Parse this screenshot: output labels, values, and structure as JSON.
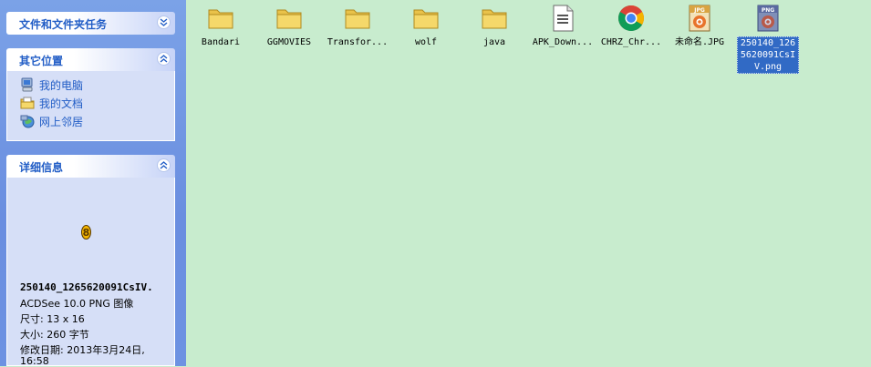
{
  "sidebar": {
    "tasks_panel": {
      "title": "文件和文件夹任务"
    },
    "places_panel": {
      "title": "其它位置",
      "links": [
        {
          "label": "我的电脑",
          "icon": "my-computer-icon"
        },
        {
          "label": "我的文档",
          "icon": "my-documents-icon"
        },
        {
          "label": "网上邻居",
          "icon": "network-places-icon"
        }
      ]
    },
    "details_panel": {
      "title": "详细信息",
      "filename": "250140_1265620091CsIV.",
      "filetype": "ACDSee 10.0 PNG 图像",
      "dimensions": "尺寸: 13 x 16",
      "size": "大小: 260 字节",
      "modified": "修改日期: 2013年3月24日,",
      "modified_time": "16:58"
    }
  },
  "files": [
    {
      "label": "Bandari",
      "type": "folder"
    },
    {
      "label": "GGMOVIES",
      "type": "folder"
    },
    {
      "label": "Transfor...",
      "type": "folder"
    },
    {
      "label": "wolf",
      "type": "folder"
    },
    {
      "label": "java",
      "type": "folder"
    },
    {
      "label": "APK_Down...",
      "type": "document"
    },
    {
      "label": "CHRZ_Chr...",
      "type": "chrome"
    },
    {
      "label": "未命名.JPG",
      "type": "jpg",
      "badge": "JPG"
    },
    {
      "label": "250140_1265620091CsIV.png",
      "type": "png",
      "badge": "PNG",
      "selected": true
    }
  ],
  "colors": {
    "sidebar_blue": "#6d92e2",
    "link_blue": "#215dc6",
    "content_bg": "#c8ecce",
    "selection": "#316ac5",
    "folder_yellow": "#f5d86a"
  }
}
